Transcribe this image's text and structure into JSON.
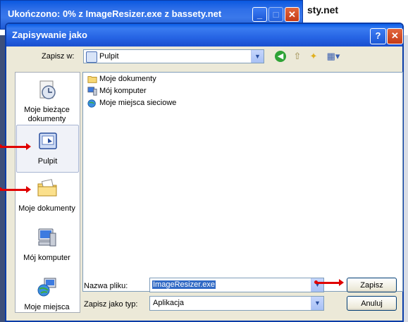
{
  "background": {
    "site_text": "sty.net",
    "download_title": "Ukończono: 0% z ImageResizer.exe z bassety.net"
  },
  "dialog": {
    "title": "Zapisywanie jako",
    "help_label": "?",
    "close_label": "✕",
    "save_in_label": "Zapisz w:",
    "location_value": "Pulpit"
  },
  "places": [
    {
      "label": "Moje bieżące dokumenty",
      "icon": "recent-documents-icon"
    },
    {
      "label": "Pulpit",
      "icon": "desktop-icon"
    },
    {
      "label": "Moje dokumenty",
      "icon": "my-documents-icon"
    },
    {
      "label": "Mój komputer",
      "icon": "my-computer-icon"
    },
    {
      "label": "Moje miejsca",
      "icon": "network-places-icon"
    }
  ],
  "files": [
    {
      "name": "Moje dokumenty",
      "icon": "folder-icon"
    },
    {
      "name": "Mój komputer",
      "icon": "computer-icon"
    },
    {
      "name": "Moje miejsca sieciowe",
      "icon": "network-icon"
    }
  ],
  "form": {
    "name_label": "Nazwa pliku:",
    "name_value": "ImageResizer.exe",
    "type_label": "Zapisz jako typ:",
    "type_value": "Aplikacja",
    "save_button": "Zapisz",
    "cancel_button": "Anuluj"
  },
  "colors": {
    "annotation_arrow": "#e00000",
    "titlebar": "#0a5ee8"
  }
}
